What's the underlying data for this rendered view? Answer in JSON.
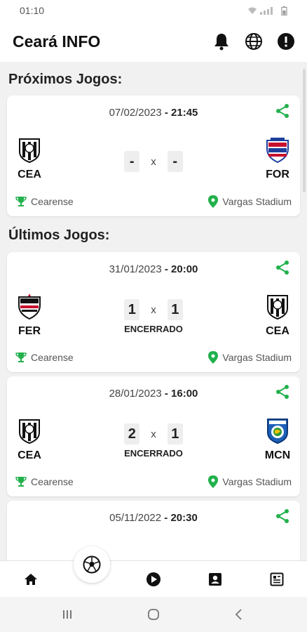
{
  "status_bar": {
    "time": "01:10"
  },
  "app": {
    "title": "Ceará INFO"
  },
  "sections": {
    "upcoming": "Próximos Jogos:",
    "recent": "Últimos Jogos:"
  },
  "upcoming_games": [
    {
      "date": "07/02/2023",
      "sep": " - ",
      "time": "21:45",
      "home": "CEA",
      "away": "FOR",
      "home_score": "-",
      "away_score": "-",
      "vs": "x",
      "status": "",
      "competition": "Cearense",
      "venue": "Vargas Stadium"
    }
  ],
  "recent_games": [
    {
      "date": "31/01/2023",
      "sep": " - ",
      "time": "20:00",
      "home": "FER",
      "away": "CEA",
      "home_score": "1",
      "away_score": "1",
      "vs": "x",
      "status": "ENCERRADO",
      "competition": "Cearense",
      "venue": "Vargas Stadium"
    },
    {
      "date": "28/01/2023",
      "sep": " - ",
      "time": "16:00",
      "home": "CEA",
      "away": "MCN",
      "home_score": "2",
      "away_score": "1",
      "vs": "x",
      "status": "ENCERRADO",
      "competition": "Cearense",
      "venue": "Vargas Stadium"
    },
    {
      "date": "05/11/2022",
      "sep": " - ",
      "time": "20:30"
    }
  ],
  "colors": {
    "accent_green": "#22b14c",
    "text": "#111111",
    "background": "#f1f1f1"
  },
  "icons": {
    "appbar": [
      "bell-icon",
      "globe-icon",
      "info-icon"
    ],
    "nav": [
      "home-icon",
      "soccer-ball-icon",
      "play-icon",
      "contact-card-icon",
      "news-icon"
    ]
  }
}
